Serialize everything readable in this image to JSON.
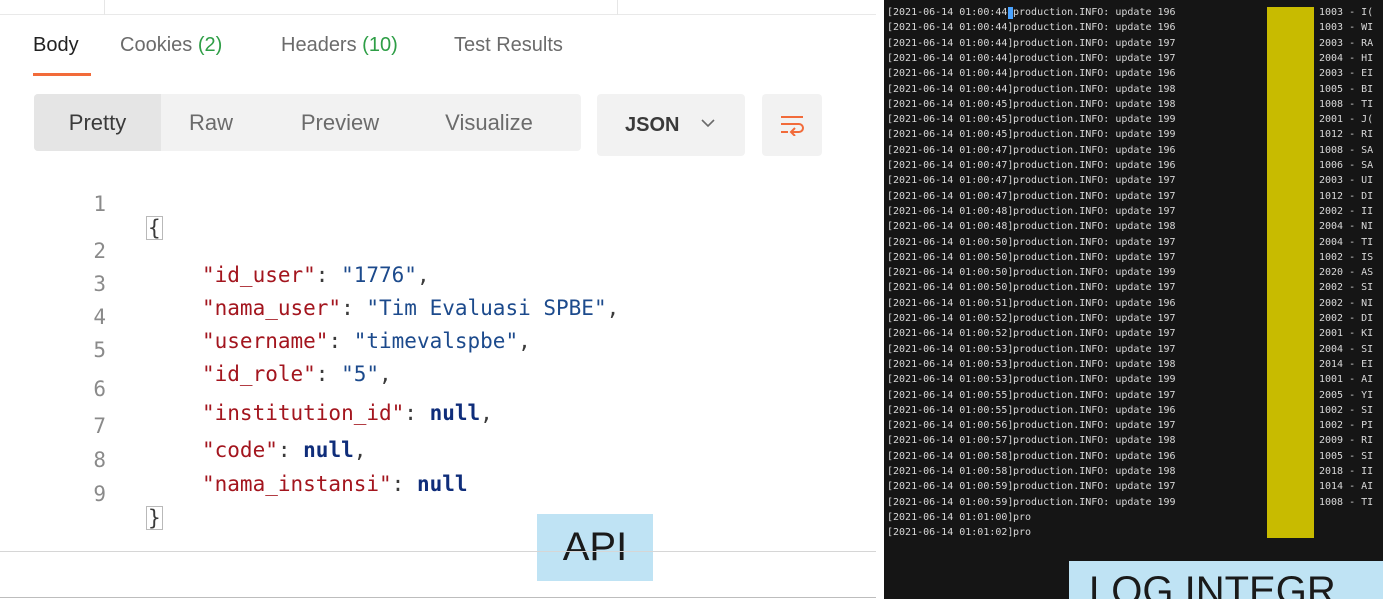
{
  "response_tabs": [
    {
      "label": "Body",
      "count": ""
    },
    {
      "label": "Cookies",
      "count": "(2)"
    },
    {
      "label": "Headers",
      "count": "(10)"
    },
    {
      "label": "Test Results",
      "count": ""
    }
  ],
  "view_modes": [
    "Pretty",
    "Raw",
    "Preview",
    "Visualize"
  ],
  "format": "JSON",
  "code": {
    "open": "{",
    "close": "}",
    "line_numbers": [
      "1",
      "2",
      "3",
      "4",
      "5",
      "6",
      "7",
      "8",
      "9"
    ],
    "fields": [
      {
        "key": "\"id_user\"",
        "value": "\"1776\"",
        "kind": "str",
        "trail": ","
      },
      {
        "key": "\"nama_user\"",
        "value": "\"Tim Evaluasi SPBE\"",
        "kind": "str",
        "trail": ","
      },
      {
        "key": "\"username\"",
        "value": "\"timevalspbe\"",
        "kind": "str",
        "trail": ","
      },
      {
        "key": "\"id_role\"",
        "value": "\"5\"",
        "kind": "str",
        "trail": ","
      },
      {
        "key": "\"institution_id\"",
        "value": "null",
        "kind": "null",
        "trail": ","
      },
      {
        "key": "\"code\"",
        "value": "null",
        "kind": "null",
        "trail": ","
      },
      {
        "key": "\"nama_instansi\"",
        "value": "null",
        "kind": "null",
        "trail": ""
      }
    ]
  },
  "api_label": "API",
  "log": {
    "prefix": "production.INFO: update",
    "rows": [
      {
        "ts": "[2021-06-14 01:00:44]",
        "id": "196",
        "tail": "1003 - I("
      },
      {
        "ts": "[2021-06-14 01:00:44]",
        "id": "196",
        "tail": "1003 - WI"
      },
      {
        "ts": "[2021-06-14 01:00:44]",
        "id": "197",
        "tail": "2003 - RA"
      },
      {
        "ts": "[2021-06-14 01:00:44]",
        "id": "197",
        "tail": "2004 - HI"
      },
      {
        "ts": "[2021-06-14 01:00:44]",
        "id": "196",
        "tail": "2003 - EI"
      },
      {
        "ts": "[2021-06-14 01:00:44]",
        "id": "198",
        "tail": "1005 - BI"
      },
      {
        "ts": "[2021-06-14 01:00:45]",
        "id": "198",
        "tail": "1008 - TI"
      },
      {
        "ts": "[2021-06-14 01:00:45]",
        "id": "199",
        "tail": "2001 - J("
      },
      {
        "ts": "[2021-06-14 01:00:45]",
        "id": "199",
        "tail": "1012 - RI"
      },
      {
        "ts": "[2021-06-14 01:00:47]",
        "id": "196",
        "tail": "1008 - SA"
      },
      {
        "ts": "[2021-06-14 01:00:47]",
        "id": "196",
        "tail": "1006 - SA"
      },
      {
        "ts": "[2021-06-14 01:00:47]",
        "id": "197",
        "tail": "2003 - UI"
      },
      {
        "ts": "[2021-06-14 01:00:47]",
        "id": "197",
        "tail": "1012 - DI"
      },
      {
        "ts": "[2021-06-14 01:00:48]",
        "id": "197",
        "tail": "2002 - II"
      },
      {
        "ts": "[2021-06-14 01:00:48]",
        "id": "198",
        "tail": "2004 - NI"
      },
      {
        "ts": "[2021-06-14 01:00:50]",
        "id": "197",
        "tail": "2004 - TI"
      },
      {
        "ts": "[2021-06-14 01:00:50]",
        "id": "197",
        "tail": "1002 - IS"
      },
      {
        "ts": "[2021-06-14 01:00:50]",
        "id": "199",
        "tail": "2020 - AS"
      },
      {
        "ts": "[2021-06-14 01:00:50]",
        "id": "197",
        "tail": "2002 - SI"
      },
      {
        "ts": "[2021-06-14 01:00:51]",
        "id": "196",
        "tail": "2002 - NI"
      },
      {
        "ts": "[2021-06-14 01:00:52]",
        "id": "197",
        "tail": "2002 - DI"
      },
      {
        "ts": "[2021-06-14 01:00:52]",
        "id": "197",
        "tail": "2001 - KI"
      },
      {
        "ts": "[2021-06-14 01:00:53]",
        "id": "197",
        "tail": "2004 - SI"
      },
      {
        "ts": "[2021-06-14 01:00:53]",
        "id": "198",
        "tail": "2014 - EI"
      },
      {
        "ts": "[2021-06-14 01:00:53]",
        "id": "199",
        "tail": "1001 - AI"
      },
      {
        "ts": "[2021-06-14 01:00:55]",
        "id": "197",
        "tail": "2005 - YI"
      },
      {
        "ts": "[2021-06-14 01:00:55]",
        "id": "196",
        "tail": "1002 - SI"
      },
      {
        "ts": "[2021-06-14 01:00:56]",
        "id": "197",
        "tail": "1002 - PI"
      },
      {
        "ts": "[2021-06-14 01:00:57]",
        "id": "198",
        "tail": "2009 - RI"
      },
      {
        "ts": "[2021-06-14 01:00:58]",
        "id": "196",
        "tail": "1005 - SI"
      },
      {
        "ts": "[2021-06-14 01:00:58]",
        "id": "198",
        "tail": "2018 - II"
      },
      {
        "ts": "[2021-06-14 01:00:59]",
        "id": "197",
        "tail": "1014 - AI"
      },
      {
        "ts": "[2021-06-14 01:00:59]",
        "id": "199",
        "tail": "1008 - TI"
      },
      {
        "ts": "[2021-06-14 01:01:00]",
        "id": "",
        "tail": "",
        "short": "pro"
      },
      {
        "ts": "[2021-06-14 01:01:02]",
        "id": "",
        "tail": "",
        "short": "pro"
      }
    ]
  },
  "log_label": "LOG INTEGR"
}
